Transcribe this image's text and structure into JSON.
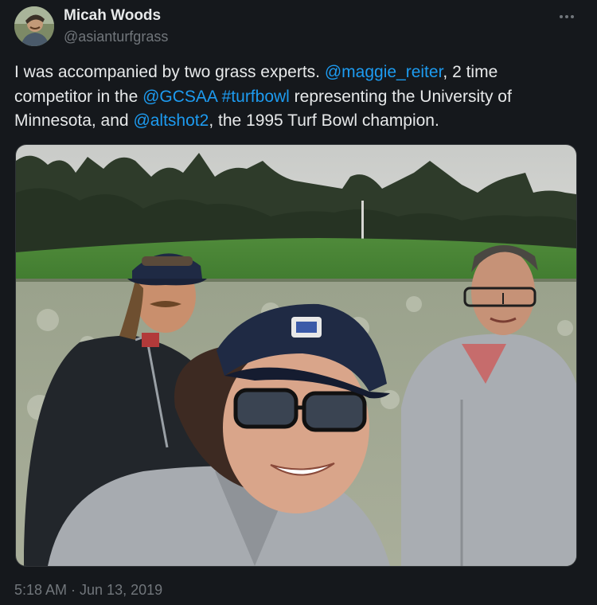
{
  "author": {
    "name": "Micah Woods",
    "handle": "@asianturfgrass"
  },
  "tweet": {
    "line1_text": "I was accompanied by two grass experts. ",
    "mention_1": "@maggie_reiter",
    "line1_tail": ", 2 time",
    "line2_text": "competitor in the ",
    "mention_2": "@GCSAA",
    "hashtag_1": "#turfbowl",
    "line2_tail": " representing the University of",
    "line3_text": "Minnesota, and ",
    "mention_3": "@altshot2",
    "line3_tail": ", the 1995 Turf Bowl champion."
  },
  "timestamp": "5:18 AM · Jun 13, 2019",
  "photo": {
    "cap_logo_text_line1": "U.S. OPEN",
    "cap_logo_text_line2": "PEBBLE BEACH"
  },
  "icons": {
    "more": "more-horizontal-icon"
  },
  "colors": {
    "background": "#15181c",
    "text_primary": "#e7e9ea",
    "text_secondary": "#71767b",
    "link": "#1d9bf0"
  }
}
